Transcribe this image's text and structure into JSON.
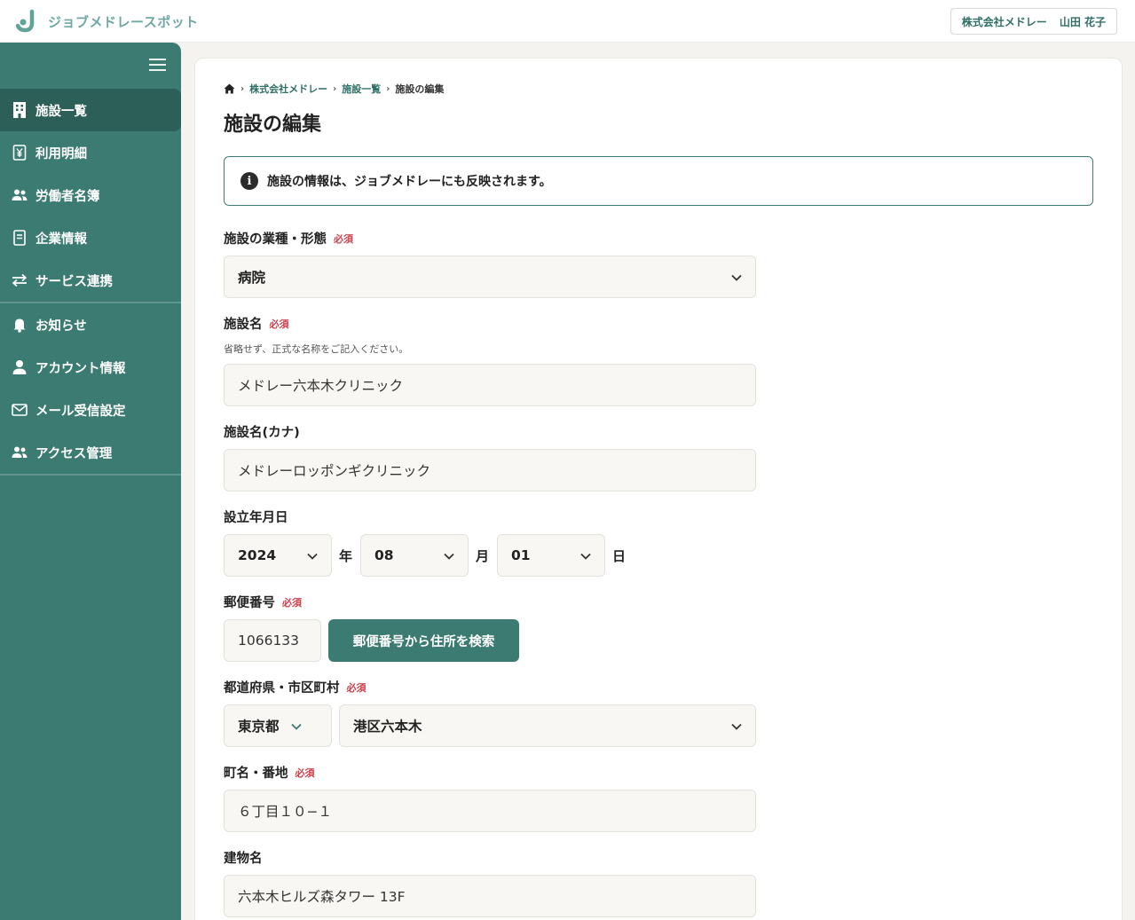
{
  "header": {
    "logo_text": "ジョブメドレースポット",
    "company": "株式会社メドレー",
    "user": "山田 花子"
  },
  "sidebar": {
    "items": [
      {
        "label": "施設一覧",
        "icon": "building-icon",
        "active": true
      },
      {
        "label": "利用明細",
        "icon": "yen-receipt-icon"
      },
      {
        "label": "労働者名簿",
        "icon": "users-icon"
      },
      {
        "label": "企業情報",
        "icon": "document-icon"
      },
      {
        "label": "サービス連携",
        "icon": "swap-arrows-icon"
      },
      {
        "label": "お知らせ",
        "icon": "bell-icon"
      },
      {
        "label": "アカウント情報",
        "icon": "person-icon"
      },
      {
        "label": "メール受信設定",
        "icon": "mail-icon"
      },
      {
        "label": "アクセス管理",
        "icon": "users-icon"
      }
    ]
  },
  "breadcrumb": {
    "items": [
      "株式会社メドレー",
      "施設一覧"
    ],
    "current": "施設の編集"
  },
  "page_title": "施設の編集",
  "notice": "施設の情報は、ジョブメドレーにも反映されます。",
  "required_badge": "必須",
  "form": {
    "business_type": {
      "label": "施設の業種・形態",
      "value": "病院"
    },
    "facility_name": {
      "label": "施設名",
      "hint": "省略せず、正式な名称をご記入ください。",
      "value": "メドレー六本木クリニック"
    },
    "facility_name_kana": {
      "label": "施設名(カナ)",
      "value": "メドレーロッポンギクリニック"
    },
    "established": {
      "label": "設立年月日",
      "year": "2024",
      "year_unit": "年",
      "month": "08",
      "month_unit": "月",
      "day": "01",
      "day_unit": "日"
    },
    "postal_code": {
      "label": "郵便番号",
      "value": "1066133",
      "search_button": "郵便番号から住所を検索"
    },
    "prefecture_city": {
      "label": "都道府県・市区町村",
      "prefecture": "東京都",
      "city": "港区六本木"
    },
    "street": {
      "label": "町名・番地",
      "value": "６丁目１０−１"
    },
    "building": {
      "label": "建物名",
      "value": "六本木ヒルズ森タワー 13F"
    }
  },
  "colors": {
    "brand": "#3b7b71",
    "brand_dark": "#2c5f57",
    "required": "#d0404e"
  }
}
